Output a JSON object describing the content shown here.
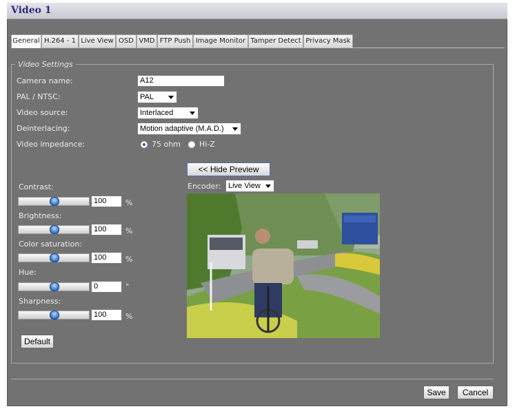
{
  "window": {
    "title": "Video 1"
  },
  "tabs": [
    {
      "label": "General",
      "active": true
    },
    {
      "label": "H.264 - 1",
      "active": false
    },
    {
      "label": "Live View",
      "active": false
    },
    {
      "label": "OSD",
      "active": false
    },
    {
      "label": "VMD",
      "active": false
    },
    {
      "label": "FTP Push",
      "active": false
    },
    {
      "label": "Image Monitor",
      "active": false
    },
    {
      "label": "Tamper Detect",
      "active": false
    },
    {
      "label": "Privacy Mask",
      "active": false
    }
  ],
  "video_settings": {
    "legend": "Video Settings",
    "camera_name": {
      "label": "Camera name:",
      "value": "A12"
    },
    "pal_ntsc": {
      "label": "PAL / NTSC:",
      "value": "PAL"
    },
    "video_source": {
      "label": "Video source:",
      "value": "Interlaced"
    },
    "deinterlacing": {
      "label": "Deinterlacing:",
      "value": "Motion adaptive (M.A.D.)"
    },
    "video_impedance": {
      "label": "Video impedance:",
      "options": [
        {
          "label": "75 ohm",
          "checked": true
        },
        {
          "label": "Hi-Z",
          "checked": false
        }
      ]
    }
  },
  "image_adjust": {
    "contrast": {
      "label": "Contrast:",
      "value": "100",
      "unit": "%",
      "level": 0.5
    },
    "brightness": {
      "label": "Brightness:",
      "value": "100",
      "unit": "%",
      "level": 0.5
    },
    "color_saturation": {
      "label": "Color saturation:",
      "value": "100",
      "unit": "%",
      "level": 0.5
    },
    "hue": {
      "label": "Hue:",
      "value": "0",
      "unit": "°",
      "level": 0.5
    },
    "sharpness": {
      "label": "Sharpness:",
      "value": "100",
      "unit": "%",
      "level": 0.5
    },
    "default_button": "Default"
  },
  "preview": {
    "hide_button": "<< Hide Preview",
    "encoder_label": "Encoder:",
    "encoder_value": "Live View"
  },
  "footer": {
    "save": "Save",
    "cancel": "Cancel"
  }
}
